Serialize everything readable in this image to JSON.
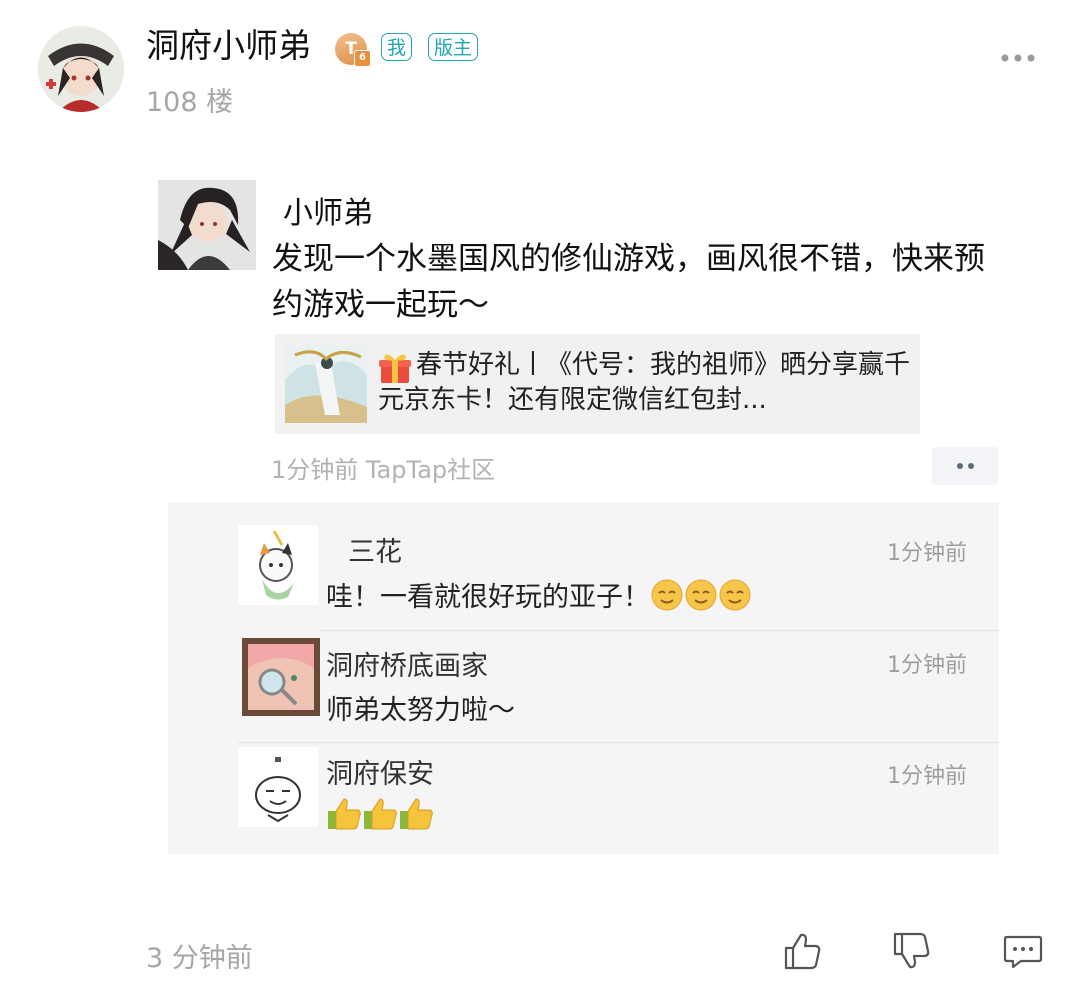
{
  "post": {
    "username": "洞府小师弟",
    "level_badge": {
      "letter": "T",
      "number": "6"
    },
    "tags": [
      "我",
      "版主"
    ],
    "floor": "108 楼",
    "post_time": "3 分钟前",
    "icons": {
      "more": "more-horizontal-icon",
      "like": "thumbs-up-icon",
      "dislike": "thumbs-down-icon",
      "comment": "comment-icon"
    }
  },
  "screenshot": {
    "author": "小师弟",
    "text": "发现一个水墨国风的修仙游戏，画风很不错，快来预约游戏一起玩～",
    "share_card": {
      "title": "春节好礼丨《代号：我的祖师》晒分享赢千元京东卡！还有限定微信红包封...",
      "icon": "gift-icon"
    },
    "meta": "1分钟前  TapTap社区",
    "comments": [
      {
        "name": "三花",
        "text": "哇！一看就很好玩的亚子！",
        "emoji": [
          "smile-emoji",
          "smile-emoji",
          "smile-emoji"
        ],
        "time": "1分钟前"
      },
      {
        "name": "洞府桥底画家",
        "text": "师弟太努力啦～",
        "emoji": [],
        "time": "1分钟前"
      },
      {
        "name": "洞府保安",
        "text": "",
        "emoji": [
          "thumbs-up-emoji",
          "thumbs-up-emoji",
          "thumbs-up-emoji"
        ],
        "time": "1分钟前"
      }
    ]
  },
  "colors": {
    "accent": "#21a6b3",
    "muted_text": "#a6a6a6",
    "comment_bg": "#f5f5f5"
  }
}
